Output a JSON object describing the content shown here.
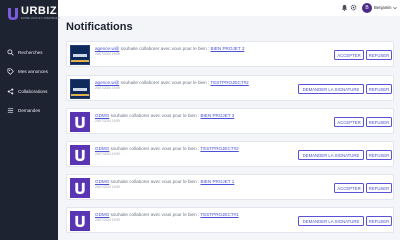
{
  "brand": {
    "name": "URBIZ",
    "tagline": "ENTRE VOUS ET L'IMMOBILIER"
  },
  "sidebar": {
    "items": [
      {
        "label": "Recherches",
        "icon": "search-icon"
      },
      {
        "label": "Mes annonces",
        "icon": "tag-icon"
      },
      {
        "label": "Collaborations",
        "icon": "share-icon"
      },
      {
        "label": "Demandes",
        "icon": "list-icon"
      }
    ]
  },
  "topbar": {
    "user_name": "Benjamin",
    "avatar_initial": "B"
  },
  "page": {
    "title": "Notifications"
  },
  "notifications": [
    {
      "sender": "agence.w@",
      "message": " souhaite collaborer avec vous pour le bien : ",
      "project": "BIEN PROJET 3",
      "date": "20/07/2024 19:59",
      "thumb": "photo",
      "primary": "ACCEPTER",
      "refuse": "REFUSER"
    },
    {
      "sender": "agence.w@",
      "message": " souhaite collaborer avec vous pour le bien : ",
      "project": "TESTPROJECT#2",
      "date": "20/07/2024 19:59",
      "thumb": "photo",
      "primary": "DEMANDER LA SIGNATURE",
      "refuse": "REFUSER"
    },
    {
      "sender": "GDMG",
      "message": " souhaite collaborer avec vous pour le bien : ",
      "project": "BIEN PROJET 3",
      "date": "20/07/2024 19:59",
      "thumb": "logo",
      "primary": "ACCEPTER",
      "refuse": "REFUSER"
    },
    {
      "sender": "GDMG",
      "message": " souhaite collaborer avec vous pour le bien : ",
      "project": "TESTPROJECT#2",
      "date": "20/07/2024 19:59",
      "thumb": "logo",
      "primary": "DEMANDER LA SIGNATURE",
      "refuse": "REFUSER"
    },
    {
      "sender": "GDMG",
      "message": " souhaite collaborer avec vous pour le bien : ",
      "project": "BIEN PROJET 1",
      "date": "20/07/2024 19:59",
      "thumb": "logo",
      "primary": "ACCEPTER",
      "refuse": "REFUSER"
    },
    {
      "sender": "GDMG",
      "message": " souhaite collaborer avec vous pour le bien : ",
      "project": "TESTPROJECT#1",
      "date": "20/07/2024 19:59",
      "thumb": "logo",
      "primary": "DEMANDER LA SIGNATURE",
      "refuse": "REFUSER"
    }
  ],
  "colors": {
    "sidebar_bg": "#1d2330",
    "accent": "#5a35b3",
    "link": "#4a52d6",
    "page_bg": "#f4f5f8"
  }
}
